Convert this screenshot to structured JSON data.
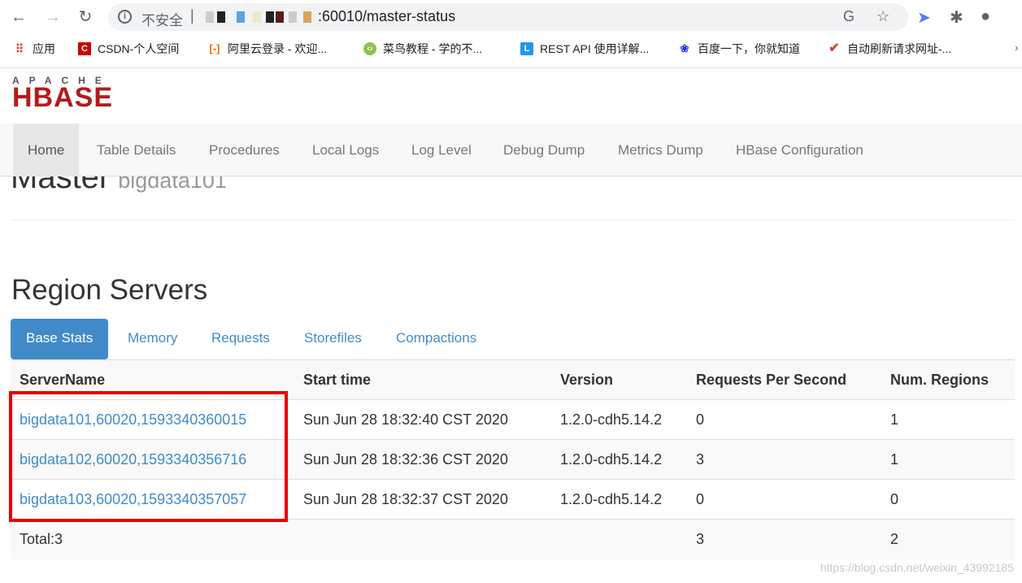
{
  "browser": {
    "insecure_label": "不安全",
    "url_visible": ":60010/master-status",
    "bookmarks": [
      {
        "label": "应用",
        "icon": "apps-grid-icon"
      },
      {
        "label": "CSDN-个人空间",
        "icon": "csdn-icon",
        "color": "#c00"
      },
      {
        "label": "阿里云登录 - 欢迎...",
        "icon": "aliyun-icon",
        "color": "#ff6a00"
      },
      {
        "label": "菜鸟教程 - 学的不...",
        "icon": "runoob-icon",
        "color": "#8bc34a"
      },
      {
        "label": "REST API 使用详解...",
        "icon": "l-icon",
        "color": "#2196f3"
      },
      {
        "label": "百度一下，你就知道",
        "icon": "baidu-paw-icon",
        "color": "#2932e1"
      },
      {
        "label": "自动刷新请求网址-...",
        "icon": "check-icon",
        "color": "#e53935"
      }
    ]
  },
  "logo": {
    "top": "APACHE",
    "main": "HBASE"
  },
  "nav": [
    "Home",
    "Table Details",
    "Procedures",
    "Local Logs",
    "Log Level",
    "Debug Dump",
    "Metrics Dump",
    "HBase Configuration"
  ],
  "master": {
    "title": "Master",
    "host": "bigdata101"
  },
  "region_servers": {
    "title": "Region Servers",
    "tabs": [
      "Base Stats",
      "Memory",
      "Requests",
      "Storefiles",
      "Compactions"
    ],
    "columns": [
      "ServerName",
      "Start time",
      "Version",
      "Requests Per Second",
      "Num. Regions"
    ],
    "rows": [
      [
        "bigdata101,60020,1593340360015",
        "Sun Jun 28 18:32:40 CST 2020",
        "1.2.0-cdh5.14.2",
        "0",
        "1"
      ],
      [
        "bigdata102,60020,1593340356716",
        "Sun Jun 28 18:32:36 CST 2020",
        "1.2.0-cdh5.14.2",
        "3",
        "1"
      ],
      [
        "bigdata103,60020,1593340357057",
        "Sun Jun 28 18:32:37 CST 2020",
        "1.2.0-cdh5.14.2",
        "0",
        "0"
      ]
    ],
    "total": {
      "label": "Total:3",
      "requests": "3",
      "regions": "2"
    }
  },
  "watermark": "https://blog.csdn.net/weixin_43992185",
  "colors": {
    "accent": "#428bca",
    "highlight_box": "#e60000",
    "logo_red": "#b31b1b"
  }
}
